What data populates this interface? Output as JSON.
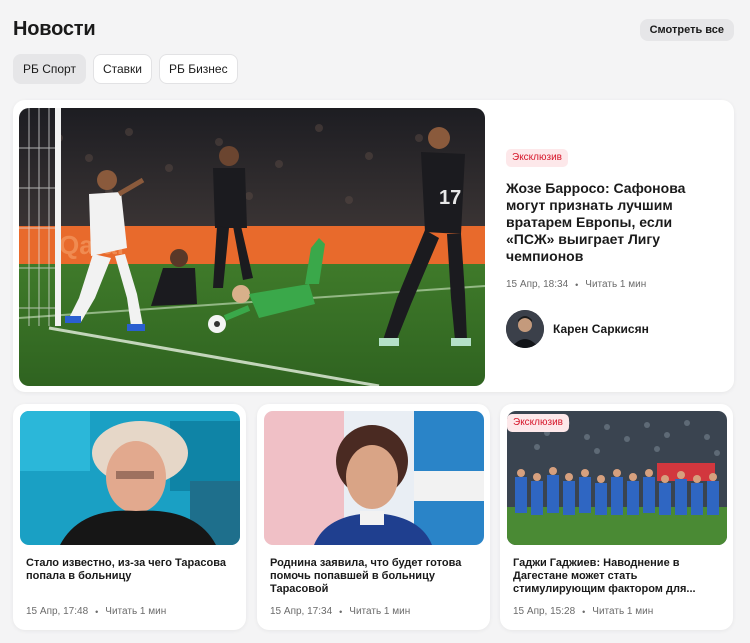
{
  "header": {
    "title": "Новости",
    "view_all_label": "Смотреть все"
  },
  "tabs": [
    {
      "label": "РБ Спорт",
      "active": true
    },
    {
      "label": "Ставки",
      "active": false
    },
    {
      "label": "РБ Бизнес",
      "active": false
    }
  ],
  "featured": {
    "badge": "Эксклюзив",
    "title": "Жозе Барросо: Сафонова могут признать лучшим вратарем Европы, если «ПСЖ» выиграет Лигу чемпионов",
    "date": "15 Апр, 18:34",
    "read_time": "Читать 1 мин",
    "author": "Карен Саркисян",
    "image_icon": "football-match-photo",
    "image_text": {
      "sponsor": "Qatar",
      "player_number": "17"
    }
  },
  "cards": [
    {
      "title": "Стало известно, из-за чего Тарасова попала в больницу",
      "date": "15 Апр, 17:48",
      "read_time": "Читать 1 мин",
      "badge": ""
    },
    {
      "title": "Роднина заявила, что будет готова помочь попавшей в больницу Тарасовой",
      "date": "15 Апр, 17:34",
      "read_time": "Читать 1 мин",
      "badge": ""
    },
    {
      "title": "Гаджи Гаджиев: Наводнение в Дагестане может стать стимулирующим фактором для...",
      "date": "15 Апр, 15:28",
      "read_time": "Читать 1 мин",
      "badge": "Эксклюзив"
    }
  ],
  "colors": {
    "accent_badge_text": "#d6182b",
    "accent_badge_bg": "#fde8ea",
    "background": "#f4f4f5"
  }
}
